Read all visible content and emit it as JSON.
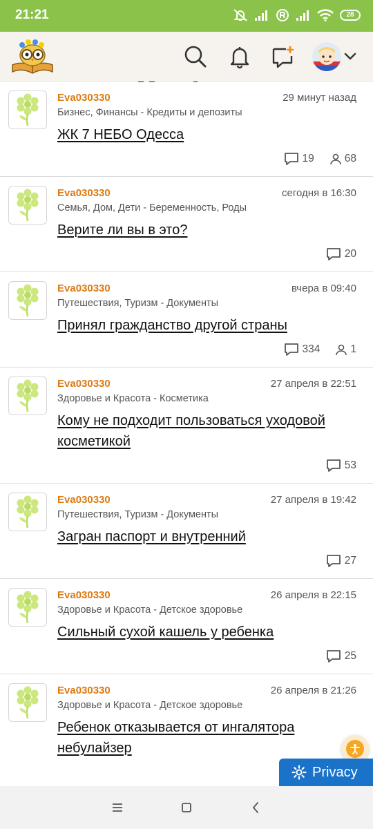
{
  "status_bar": {
    "time": "21:21",
    "battery": "28",
    "icons": [
      "mute-icon",
      "signal-icon",
      "registered-icon",
      "signal-icon",
      "wifi-icon",
      "battery-icon"
    ]
  },
  "header": {
    "logo": "owl-book-logo",
    "icons": [
      "search-icon",
      "bell-icon",
      "new-message-icon",
      "avatar",
      "chevron-down-icon"
    ]
  },
  "colors": {
    "status_bar": "#8bc34a",
    "author": "#dd7a12",
    "privacy_button": "#1a73c9",
    "flower": "#cbe77d"
  },
  "posts": [
    {
      "author": "Eva030330",
      "date": "29 минут назад",
      "category": "Бизнес, Финансы - Кредиты и депозиты",
      "title": "ЖК 7 НЕБО Одесса",
      "comments": "19",
      "users": "68"
    },
    {
      "author": "Eva030330",
      "date": "сегодня в 16:30",
      "category": "Семья, Дом, Дети - Беременность, Роды",
      "title": "Верите ли вы в это?",
      "comments": "20"
    },
    {
      "author": "Eva030330",
      "date": "вчера в 09:40",
      "category": "Путешествия, Туризм - Документы",
      "title": "Принял гражданство другой страны",
      "comments": "334",
      "users": "1"
    },
    {
      "author": "Eva030330",
      "date": "27 апреля в 22:51",
      "category": "Здоровье и Красота - Косметика",
      "title": "Кому не подходит пользоваться уходовой косметикой",
      "comments": "53"
    },
    {
      "author": "Eva030330",
      "date": "27 апреля в 19:42",
      "category": "Путешествия, Туризм - Документы",
      "title": "Загран паспорт и внутренний",
      "comments": "27"
    },
    {
      "author": "Eva030330",
      "date": "26 апреля в 22:15",
      "category": "Здоровье и Красота - Детское здоровье",
      "title": "Сильный сухой кашель у ребенка",
      "comments": "25"
    },
    {
      "author": "Eva030330",
      "date": "26 апреля в 21:26",
      "category": "Здоровье и Красота - Детское здоровье",
      "title": "Ребенок отказывается от ингалятора небулайзер"
    }
  ],
  "privacy": {
    "label": "Privacy"
  },
  "nav_bar": {
    "icons": [
      "menu-icon",
      "home-icon",
      "back-icon"
    ]
  }
}
